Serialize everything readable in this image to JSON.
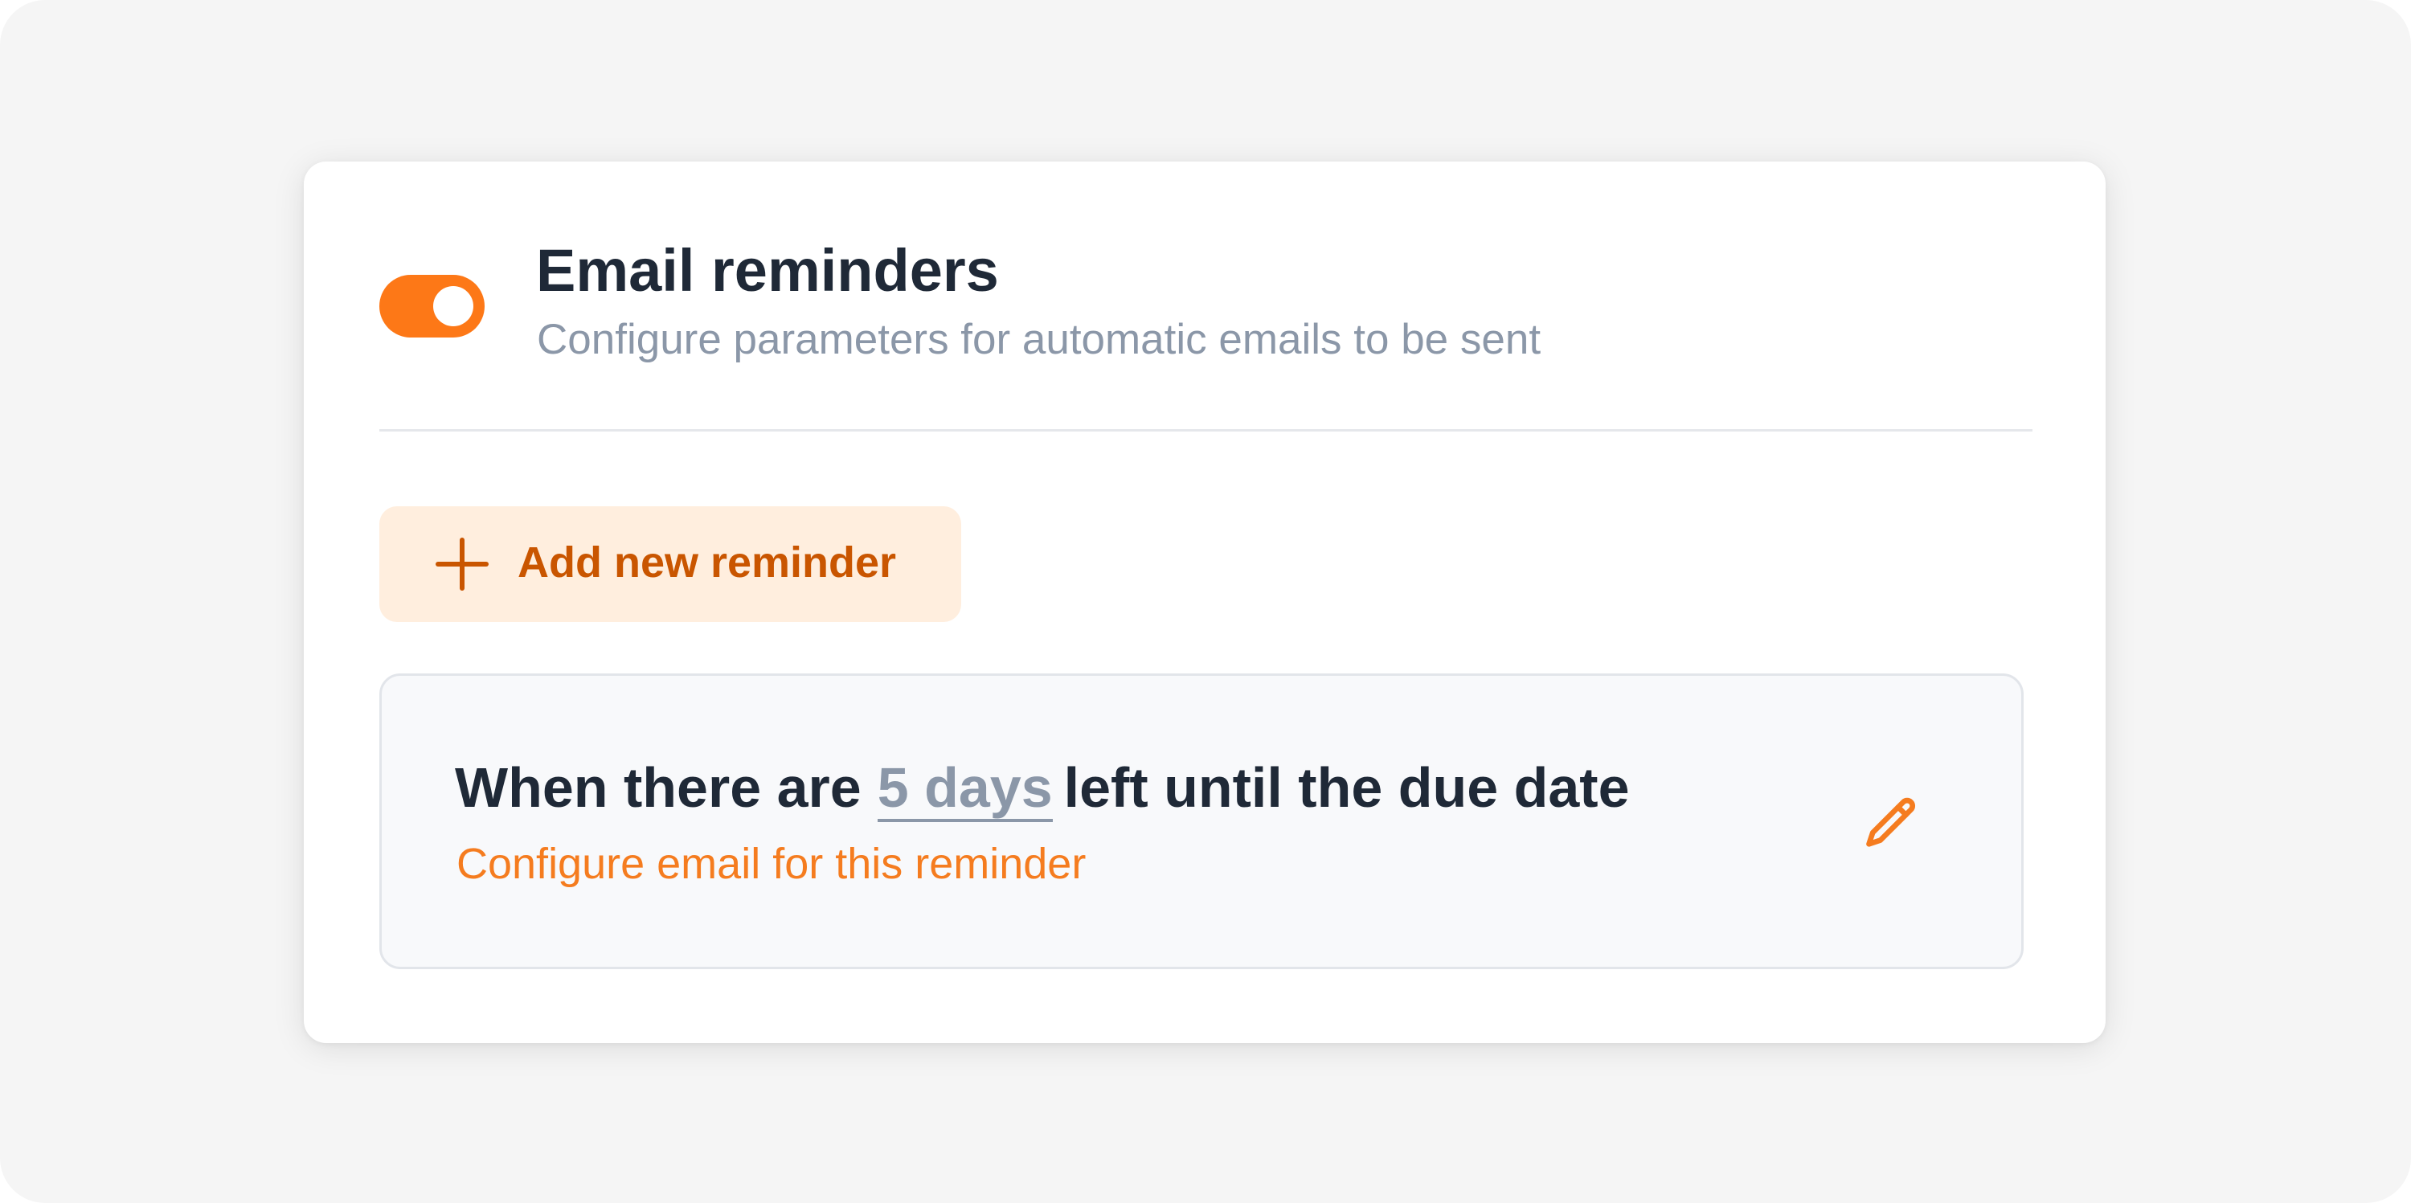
{
  "header": {
    "toggle_state": "on",
    "title": "Email reminders",
    "subtitle": "Configure parameters for automatic emails to be sent"
  },
  "add_button": {
    "label": "Add new reminder",
    "icon": "plus-icon"
  },
  "reminder": {
    "text_before": "When there are",
    "days_value": "5 days",
    "text_after": "left until the due date",
    "link": "Configure email for this reminder",
    "edit_icon": "pencil-icon"
  },
  "colors": {
    "accent": "#fd7817",
    "accent_dark": "#c95500",
    "accent_soft": "#ffeede",
    "heading": "#1f2937",
    "muted": "#8b97a8"
  }
}
